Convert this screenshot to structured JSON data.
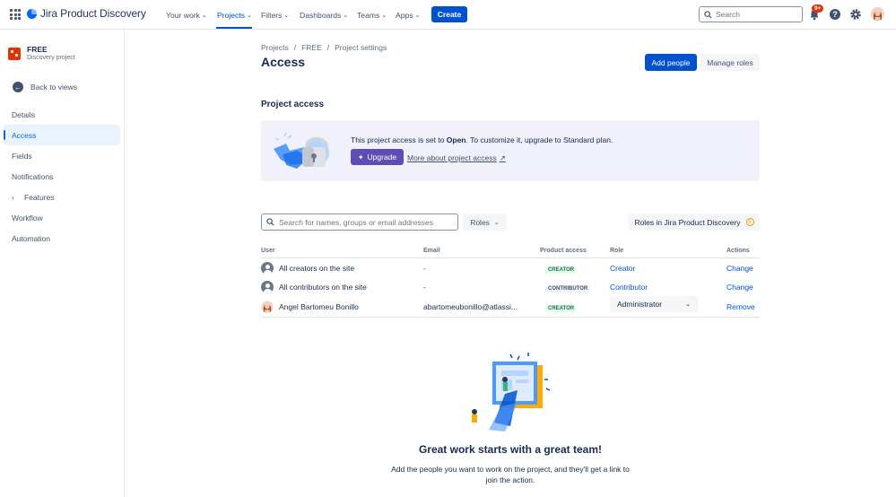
{
  "topnav": {
    "product": "Jira Product Discovery",
    "items": [
      {
        "label": "Your work"
      },
      {
        "label": "Projects"
      },
      {
        "label": "Filters"
      },
      {
        "label": "Dashboards"
      },
      {
        "label": "Teams"
      },
      {
        "label": "Apps"
      }
    ],
    "create_label": "Create",
    "search_placeholder": "Search",
    "notifications_badge": "9+"
  },
  "sidebar": {
    "project_name": "FREE",
    "project_type": "Discovery project",
    "back_label": "Back to views",
    "items": [
      {
        "label": "Details"
      },
      {
        "label": "Access"
      },
      {
        "label": "Fields"
      },
      {
        "label": "Notifications"
      },
      {
        "label": "Features"
      },
      {
        "label": "Workflow"
      },
      {
        "label": "Automation"
      }
    ]
  },
  "header": {
    "breadcrumbs": [
      "Projects",
      "FREE",
      "Project settings"
    ],
    "title": "Access",
    "add_people_label": "Add people",
    "manage_roles_label": "Manage roles"
  },
  "project_access": {
    "heading": "Project access",
    "banner_text_pre": "This project access is set to ",
    "banner_text_bold": "Open",
    "banner_text_post": ". To customize it, upgrade to Standard plan.",
    "upgrade_label": "Upgrade",
    "more_link": "More about project access"
  },
  "filters": {
    "search_placeholder": "Search for names, groups or email addresses",
    "roles_label": "Roles",
    "roles_jpd_label": "Roles in Jira Product Discovery"
  },
  "table": {
    "columns": [
      "User",
      "Email",
      "Product access",
      "Role",
      "Actions"
    ],
    "rows": [
      {
        "user": "All creators on the site",
        "email": "-",
        "access": "CREATOR",
        "role": "Creator",
        "action": "Change"
      },
      {
        "user": "All contributors on the site",
        "email": "-",
        "access": "CONTRIBUTOR",
        "role": "Contributor",
        "action": "Change"
      },
      {
        "user": "Angel Bartomeu Bonillo",
        "email": "abartomeubonillo@atlassi...",
        "access": "CREATOR",
        "role": "Administrator",
        "action": "Remove"
      }
    ]
  },
  "empty_state": {
    "title": "Great work starts with a great team!",
    "description": "Add the people you want to work on the project, and they'll get a link to join the action."
  },
  "colors": {
    "brand": "#0052cc",
    "upgrade": "#5e4db2",
    "banner_bg": "#f0f1fb",
    "selected_bg": "#e9f2ff"
  }
}
